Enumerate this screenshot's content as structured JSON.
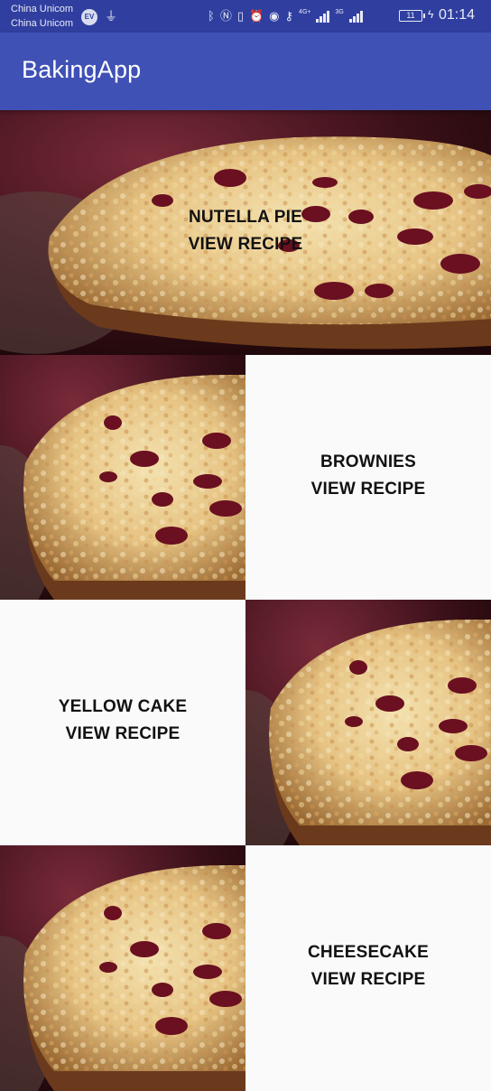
{
  "status_bar": {
    "carrier_1": "China Unicom",
    "carrier_2": "China Unicom",
    "ev_badge": "EV",
    "net_4g": "4G+",
    "net_3g": "3G",
    "battery": "11",
    "time": "01:14",
    "icons": [
      "usb-icon",
      "bluetooth-icon",
      "nfc-icon",
      "vibrate-icon",
      "alarm-icon",
      "eye-icon",
      "key-icon",
      "charging-icon"
    ]
  },
  "app_bar": {
    "title": "BakingApp"
  },
  "recipes": [
    {
      "name": "NUTELLA PIE",
      "action": "VIEW RECIPE",
      "has_image": true
    },
    {
      "name": "BROWNIES",
      "action": "VIEW RECIPE",
      "has_image": false
    },
    {
      "name": "YELLOW CAKE",
      "action": "VIEW RECIPE",
      "has_image": false
    },
    {
      "name": "CHEESECAKE",
      "action": "VIEW RECIPE",
      "has_image": false
    }
  ],
  "colors": {
    "status_bar": "#303f9f",
    "app_bar": "#3f51b5",
    "background": "#fafafa",
    "text": "#111111"
  }
}
